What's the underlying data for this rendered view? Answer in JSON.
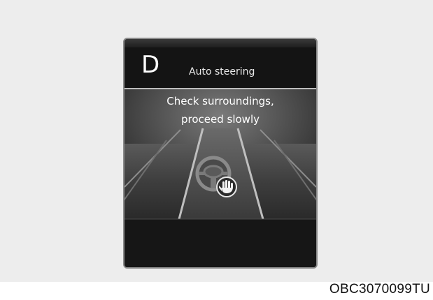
{
  "display": {
    "gear": "D",
    "mode_title": "Auto steering",
    "message_line1": "Check surroundings,",
    "message_line2": "proceed slowly"
  },
  "icons": {
    "steering_wheel": "steering-wheel-icon",
    "hand": "hand-icon"
  },
  "colors": {
    "screen_bg": "#141414",
    "road_surface": "#3a3a3a",
    "text": "#ffffff"
  },
  "figure": {
    "code": "OBC3070099TU"
  }
}
